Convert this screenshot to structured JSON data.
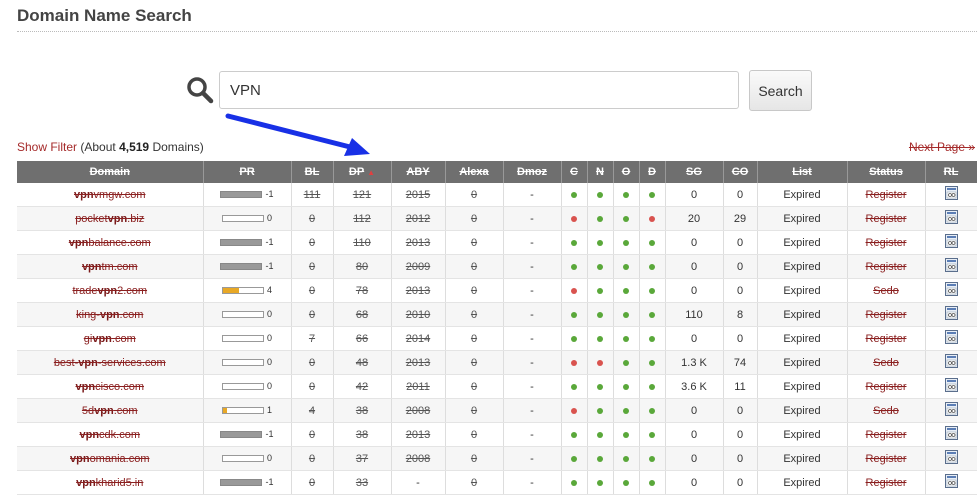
{
  "header": {
    "title": "Domain Name Search"
  },
  "search": {
    "value": "VPN",
    "button_label": "Search"
  },
  "filter": {
    "show_filter": "Show Filter",
    "about_prefix": "(About ",
    "count": "4,519",
    "about_suffix": " Domains)",
    "next_page": "Next Page »"
  },
  "colors": {
    "arrow": "#1830e6",
    "header_bg": "#6f6f6f",
    "link": "#8b2020",
    "dot_green": "#5aa83a",
    "dot_red": "#d9534f",
    "pr_orange": "#e8a826"
  },
  "table": {
    "columns": [
      "Domain",
      "PR",
      "BL",
      "DP",
      "ABY",
      "Alexa",
      "Dmoz",
      "C",
      "N",
      "O",
      "D",
      "SG",
      "CO",
      "List",
      "Status",
      "RL"
    ],
    "sort_indicator": "▲",
    "rows": [
      {
        "pre": "",
        "bold": "vpn",
        "post": "vmgw.com",
        "pr": "-1",
        "pr_fill": "gray",
        "bl": "111",
        "dp": "121",
        "aby": "2015",
        "alexa": "0",
        "dmoz": "-",
        "c": "g",
        "n": "g",
        "o": "g",
        "d": "g",
        "sg": "0",
        "co": "0",
        "list": "Expired",
        "status": "Register"
      },
      {
        "pre": "pocket",
        "bold": "vpn",
        "post": ".biz",
        "pr": "0",
        "pr_fill": 0,
        "bl": "0",
        "dp": "112",
        "aby": "2012",
        "alexa": "0",
        "dmoz": "-",
        "c": "r",
        "n": "g",
        "o": "g",
        "d": "r",
        "sg": "20",
        "co": "29",
        "list": "Expired",
        "status": "Register"
      },
      {
        "pre": "",
        "bold": "vpn",
        "post": "balance.com",
        "pr": "-1",
        "pr_fill": "gray",
        "bl": "0",
        "dp": "110",
        "aby": "2013",
        "alexa": "0",
        "dmoz": "-",
        "c": "g",
        "n": "g",
        "o": "g",
        "d": "g",
        "sg": "0",
        "co": "0",
        "list": "Expired",
        "status": "Register"
      },
      {
        "pre": "",
        "bold": "vpn",
        "post": "tm.com",
        "pr": "-1",
        "pr_fill": "gray",
        "bl": "0",
        "dp": "80",
        "aby": "2009",
        "alexa": "0",
        "dmoz": "-",
        "c": "g",
        "n": "g",
        "o": "g",
        "d": "g",
        "sg": "0",
        "co": "0",
        "list": "Expired",
        "status": "Register"
      },
      {
        "pre": "trade",
        "bold": "vpn",
        "post": "2.com",
        "pr": "4",
        "pr_fill": 0.4,
        "bl": "0",
        "dp": "78",
        "aby": "2013",
        "alexa": "0",
        "dmoz": "-",
        "c": "r",
        "n": "g",
        "o": "g",
        "d": "g",
        "sg": "0",
        "co": "0",
        "list": "Expired",
        "status": "Sedo"
      },
      {
        "pre": "king-",
        "bold": "vpn",
        "post": ".com",
        "pr": "0",
        "pr_fill": 0,
        "bl": "0",
        "dp": "68",
        "aby": "2010",
        "alexa": "0",
        "dmoz": "-",
        "c": "g",
        "n": "g",
        "o": "g",
        "d": "g",
        "sg": "110",
        "co": "8",
        "list": "Expired",
        "status": "Register"
      },
      {
        "pre": "gi",
        "bold": "vpn",
        "post": ".com",
        "pr": "0",
        "pr_fill": 0,
        "bl": "7",
        "dp": "66",
        "aby": "2014",
        "alexa": "0",
        "dmoz": "-",
        "c": "g",
        "n": "g",
        "o": "g",
        "d": "g",
        "sg": "0",
        "co": "0",
        "list": "Expired",
        "status": "Register"
      },
      {
        "pre": "best-",
        "bold": "vpn",
        "post": "-services.com",
        "pr": "0",
        "pr_fill": 0,
        "bl": "0",
        "dp": "48",
        "aby": "2013",
        "alexa": "0",
        "dmoz": "-",
        "c": "r",
        "n": "r",
        "o": "g",
        "d": "g",
        "sg": "1.3 K",
        "co": "74",
        "list": "Expired",
        "status": "Sedo"
      },
      {
        "pre": "",
        "bold": "vpn",
        "post": "cisco.com",
        "pr": "0",
        "pr_fill": 0,
        "bl": "0",
        "dp": "42",
        "aby": "2011",
        "alexa": "0",
        "dmoz": "-",
        "c": "g",
        "n": "g",
        "o": "g",
        "d": "g",
        "sg": "3.6 K",
        "co": "11",
        "list": "Expired",
        "status": "Register"
      },
      {
        "pre": "5d",
        "bold": "vpn",
        "post": ".com",
        "pr": "1",
        "pr_fill": 0.1,
        "bl": "4",
        "dp": "38",
        "aby": "2008",
        "alexa": "0",
        "dmoz": "-",
        "c": "r",
        "n": "g",
        "o": "g",
        "d": "g",
        "sg": "0",
        "co": "0",
        "list": "Expired",
        "status": "Sedo"
      },
      {
        "pre": "",
        "bold": "vpn",
        "post": "cdk.com",
        "pr": "-1",
        "pr_fill": "gray",
        "bl": "0",
        "dp": "38",
        "aby": "2013",
        "alexa": "0",
        "dmoz": "-",
        "c": "g",
        "n": "g",
        "o": "g",
        "d": "g",
        "sg": "0",
        "co": "0",
        "list": "Expired",
        "status": "Register"
      },
      {
        "pre": "",
        "bold": "vpn",
        "post": "omania.com",
        "pr": "0",
        "pr_fill": 0,
        "bl": "0",
        "dp": "37",
        "aby": "2008",
        "alexa": "0",
        "dmoz": "-",
        "c": "g",
        "n": "g",
        "o": "g",
        "d": "g",
        "sg": "0",
        "co": "0",
        "list": "Expired",
        "status": "Register"
      },
      {
        "pre": "",
        "bold": "vpn",
        "post": "kharid5.in",
        "pr": "-1",
        "pr_fill": "gray",
        "bl": "0",
        "dp": "33",
        "aby": "-",
        "alexa": "0",
        "dmoz": "-",
        "c": "g",
        "n": "g",
        "o": "g",
        "d": "g",
        "sg": "0",
        "co": "0",
        "list": "Expired",
        "status": "Register"
      }
    ]
  }
}
